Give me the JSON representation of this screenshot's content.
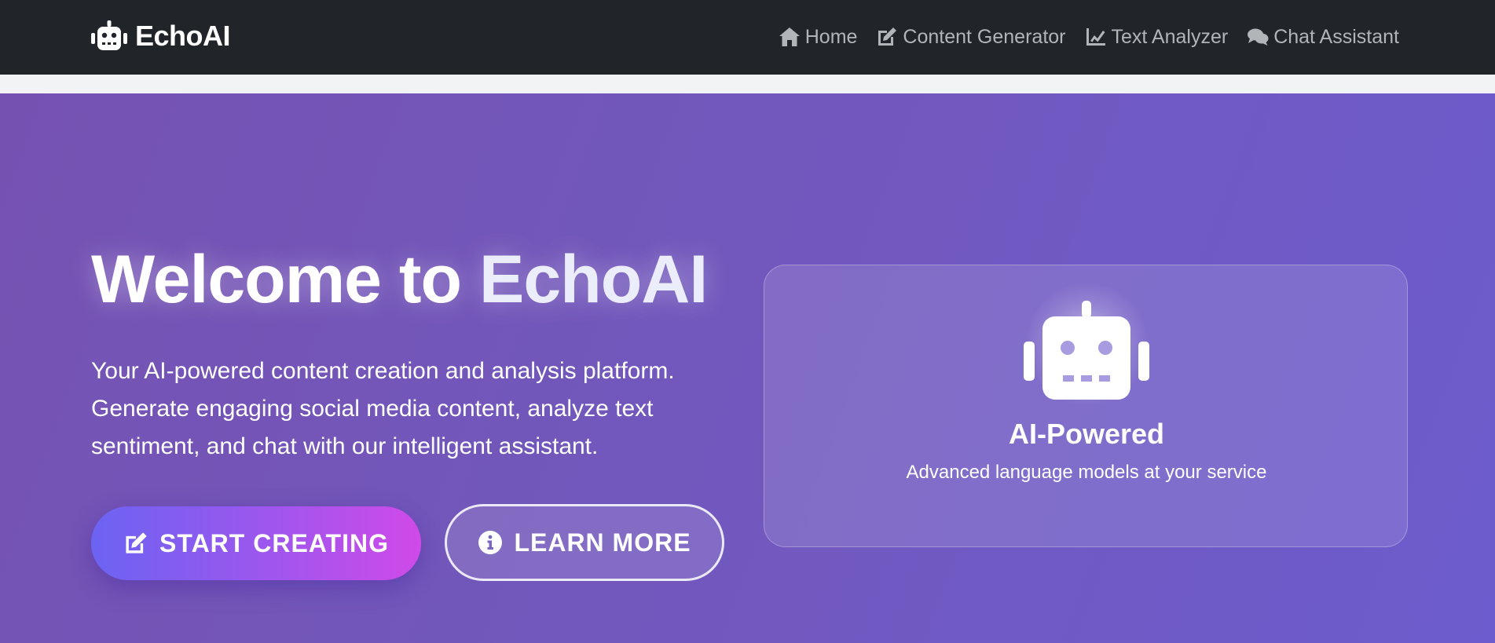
{
  "brand": {
    "name": "EchoAI",
    "icon": "robot-icon"
  },
  "nav": {
    "items": [
      {
        "label": "Home",
        "icon": "home-icon"
      },
      {
        "label": "Content Generator",
        "icon": "edit-icon"
      },
      {
        "label": "Text Analyzer",
        "icon": "chart-line-icon"
      },
      {
        "label": "Chat Assistant",
        "icon": "comments-icon"
      }
    ]
  },
  "hero": {
    "title_prefix": "Welcome to ",
    "title_accent": "EchoAI",
    "description": "Your AI-powered content creation and analysis platform. Generate engaging social media content, analyze text sentiment, and chat with our intelligent assistant.",
    "primary_button": "START CREATING",
    "secondary_button": "LEARN MORE"
  },
  "feature_card": {
    "title": "AI-Powered",
    "subtitle": "Advanced language models at your service",
    "icon": "robot-icon"
  },
  "colors": {
    "navbar": "#212529",
    "nav_link": "#b2b5b8",
    "hero_gradient_start": "#7552b2",
    "hero_gradient_end": "#6d5ccd",
    "primary_button_start": "#6c63f2",
    "primary_button_end": "#d04ae8"
  }
}
